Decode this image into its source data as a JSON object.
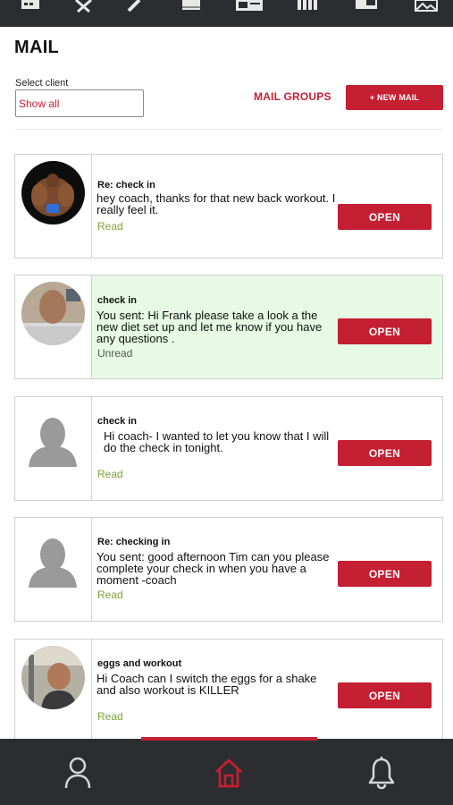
{
  "header": {
    "title": "MAIL",
    "top_icons": [
      "calendar-icon",
      "tools-icon",
      "pen-icon",
      "book-icon",
      "id-card-icon",
      "bar-chart-icon",
      "window-icon",
      "image-icon"
    ]
  },
  "filters": {
    "select_label": "Select client",
    "select_value": "Show all",
    "mail_groups_label": "MAIL GROUPS",
    "new_mail_label": "+ NEW MAIL"
  },
  "colors": {
    "accent": "#c41f32",
    "nav_bg": "#2b2d30",
    "unread_bg": "#e6fae4",
    "read_status": "#7aa33a"
  },
  "messages": [
    {
      "subject": "Re: check in",
      "body": "hey coach, thanks for that new back workout. I really feel it.",
      "status": "Read",
      "open_label": "OPEN",
      "avatar": "bodybuilder-photo"
    },
    {
      "subject": "check in",
      "body": "You sent: Hi Frank please take a look a the new diet set up and let me know if you have any questions .",
      "status": "Unread",
      "open_label": "OPEN",
      "avatar": "man-photo"
    },
    {
      "subject": "check in",
      "body": "Hi coach- I wanted to let you know that I will do the check in tonight.",
      "status": "Read",
      "open_label": "OPEN",
      "avatar": "default-person"
    },
    {
      "subject": "Re: checking in",
      "body": "You sent: good afternoon Tim can you please complete your check in when you have a moment -coach",
      "status": "Read",
      "open_label": "OPEN",
      "avatar": "default-person"
    },
    {
      "subject": "eggs and workout",
      "body": "Hi Coach can I switch the eggs for a shake and also workout is KILLER",
      "status": "Read",
      "open_label": "OPEN",
      "avatar": "gym-photo"
    }
  ],
  "bottom_nav": [
    {
      "name": "profile",
      "icon": "person-icon",
      "active": false
    },
    {
      "name": "home",
      "icon": "home-icon",
      "active": true
    },
    {
      "name": "notifications",
      "icon": "bell-icon",
      "active": false
    }
  ]
}
